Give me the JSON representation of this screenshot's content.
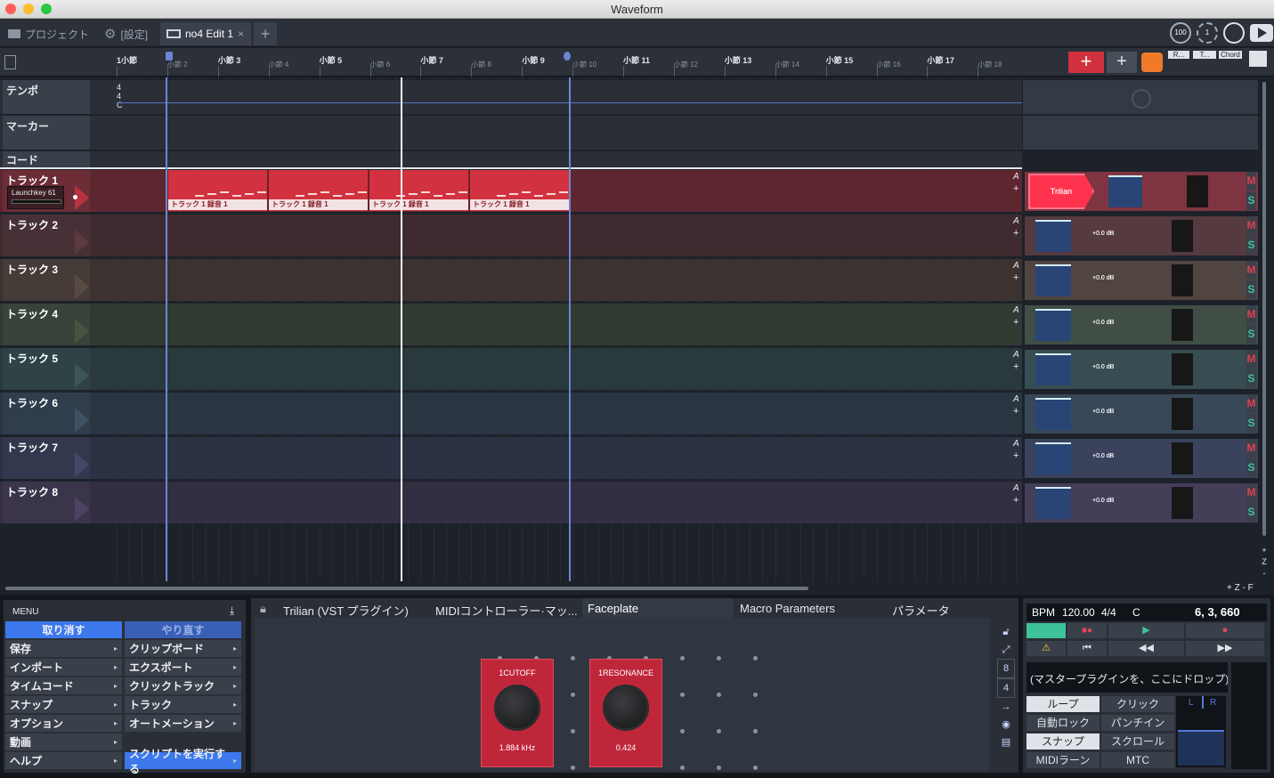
{
  "window": {
    "title": "Waveform"
  },
  "tabs": [
    {
      "label": "プロジェクト"
    },
    {
      "label": "[設定]"
    },
    {
      "label": "no4 Edit 1",
      "close": "×"
    },
    {
      "label": "+"
    }
  ],
  "top_right": {
    "zoom": "100",
    "other": "1"
  },
  "ruler": {
    "bars": [
      "1小節",
      "小節 2",
      "小節 3",
      "小節 4",
      "小節 5",
      "小節 6",
      "小節 7",
      "小節 8",
      "小節 9",
      "小節 10",
      "小節 11",
      "小節 12",
      "小節 13",
      "小節 14",
      "小節 15",
      "小節 16",
      "小節 17",
      "小節 18"
    ],
    "right_buttons": [
      "R...",
      "T...",
      "Chord"
    ],
    "add_label": "+"
  },
  "lanes": {
    "tempo": {
      "label": "テンポ",
      "sig": [
        "4",
        "4",
        "C"
      ]
    },
    "marker": {
      "label": "マーカー"
    },
    "chord": {
      "label": "コード"
    }
  },
  "tracks": [
    {
      "name": "トラック 1",
      "input": "Launchkey 61",
      "plugin": "Trilian",
      "color": "#5e2730",
      "tri": "#b8323f",
      "letter": "A",
      "plus": "+",
      "mute": "M",
      "solo": "S"
    },
    {
      "name": "トラック 2",
      "vol": "+0.0 dB",
      "color": "#3f2b2f",
      "tri": "#5c3a3f",
      "letter": "A",
      "plus": "+",
      "mute": "M",
      "solo": "S"
    },
    {
      "name": "トラック 3",
      "vol": "+0.0 dB",
      "color": "#3c3330",
      "tri": "#584a40",
      "letter": "A",
      "plus": "+",
      "mute": "M",
      "solo": "S"
    },
    {
      "name": "トラック 4",
      "vol": "+0.0 dB",
      "color": "#303a33",
      "tri": "#47553f",
      "letter": "A",
      "plus": "+",
      "mute": "M",
      "solo": "S"
    },
    {
      "name": "トラック 5",
      "vol": "+0.0 dB",
      "color": "#29393c",
      "tri": "#3d5558",
      "letter": "A",
      "plus": "+",
      "mute": "M",
      "solo": "S"
    },
    {
      "name": "トラック 6",
      "vol": "+0.0 dB",
      "color": "#2a3542",
      "tri": "#3e5163",
      "letter": "A",
      "plus": "+",
      "mute": "M",
      "solo": "S"
    },
    {
      "name": "トラック 7",
      "vol": "+0.0 dB",
      "color": "#2c3144",
      "tri": "#404a66",
      "letter": "A",
      "plus": "+",
      "mute": "M",
      "solo": "S"
    },
    {
      "name": "トラック 8",
      "vol": "+0.0 dB",
      "color": "#332e42",
      "tri": "#4c4363",
      "letter": "A",
      "plus": "+",
      "mute": "M",
      "solo": "S"
    }
  ],
  "clips": [
    {
      "label": "トラック 1 録音 1"
    },
    {
      "label": "トラック 1 録音 1"
    },
    {
      "label": "トラック 1 録音 1"
    },
    {
      "label": "トラック 1 録音 1"
    }
  ],
  "menu": {
    "title": "MENU",
    "undo": "取り消す",
    "redo": "やり直す",
    "left": [
      "保存",
      "インポート",
      "タイムコード",
      "スナップ",
      "オプション",
      "動画",
      "ヘルプ"
    ],
    "right": [
      "クリップボード",
      "エクスポート",
      "クリックトラック",
      "トラック",
      "オートメーション",
      "",
      "スクリプトを実行する"
    ]
  },
  "plugin_tabs": [
    "Trilian (VST プラグイン)",
    "MIDIコントローラー·マッ...",
    "Faceplate",
    "Macro Parameters",
    "パラメータ"
  ],
  "faceplate": {
    "knobs": [
      {
        "label": "1CUTOFF",
        "value": "1.884 kHz"
      },
      {
        "label": "1RESONANCE",
        "value": "0.424"
      }
    ],
    "side": [
      "8",
      "4"
    ]
  },
  "transport": {
    "bpm_label": "BPM",
    "bpm": "120.00",
    "sig": "4/4",
    "key": "C",
    "position": "6, 3, 660",
    "master_drop": "(マスタープラグインを、ここにドロップ)",
    "toggles": [
      "ループ",
      "クリック",
      "自動ロック",
      "パンチイン",
      "スナップ",
      "スクロール",
      "MIDIラーン",
      "MTC"
    ],
    "lr": [
      "L",
      "R"
    ]
  },
  "bottom_right": {
    "zoom": "+ Z - F"
  }
}
